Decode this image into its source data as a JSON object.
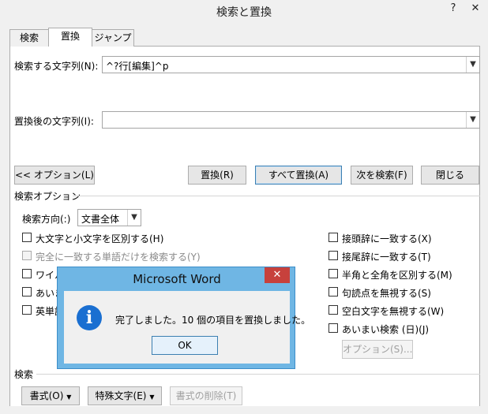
{
  "window": {
    "title": "検索と置換",
    "help": "?",
    "close": "✕"
  },
  "tabs": [
    {
      "label": "検索"
    },
    {
      "label": "置換"
    },
    {
      "label": "ジャンプ"
    }
  ],
  "find": {
    "label": "検索する文字列(N):",
    "value": "^?行[編集]^p"
  },
  "replace": {
    "label": "置換後の文字列(I):",
    "value": ""
  },
  "buttons": {
    "options": "<< オプション(L)",
    "replace": "置換(R)",
    "replace_all": "すべて置換(A)",
    "find_next": "次を検索(F)",
    "close": "閉じる"
  },
  "search_options": {
    "heading": "検索オプション",
    "direction_label": "検索方向(:)",
    "direction_value": "文書全体",
    "left": [
      {
        "label": "大文字と小文字を区別する(H)",
        "disabled": false
      },
      {
        "label": "完全に一致する単語だけを検索する(Y)",
        "disabled": true
      },
      {
        "label": "ワイル",
        "disabled": false
      },
      {
        "label": "あいま",
        "disabled": false
      },
      {
        "label": "英単語",
        "disabled": false
      }
    ],
    "right": [
      {
        "label": "接頭辞に一致する(X)"
      },
      {
        "label": "接尾辞に一致する(T)"
      },
      {
        "label": "半角と全角を区別する(M)"
      },
      {
        "label": "句読点を無視する(S)"
      },
      {
        "label": "空白文字を無視する(W)"
      },
      {
        "label": "あいまい検索 (日)(J)"
      }
    ],
    "fuzzy_options_button": "オプション(S)..."
  },
  "replace_section": {
    "heading": "検索",
    "format_button": "書式(O)",
    "special_button": "特殊文字(E)",
    "clear_format_button": "書式の削除(T)"
  },
  "message_box": {
    "title": "Microsoft Word",
    "close": "✕",
    "icon_glyph": "i",
    "message": "完了しました。10 個の項目を置換しました。",
    "ok": "OK"
  }
}
